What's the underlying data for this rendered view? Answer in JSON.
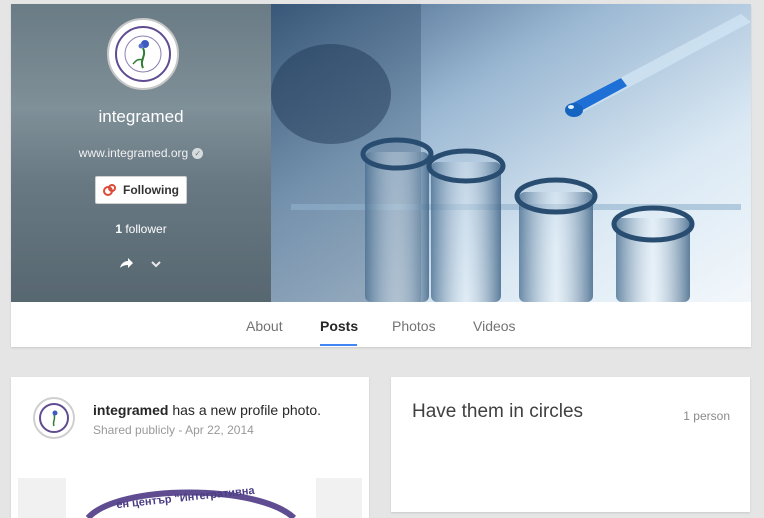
{
  "profile": {
    "name": "integramed",
    "website": "www.integramed.org",
    "follow_label": "Following",
    "followers_count": "1",
    "followers_label": " follower"
  },
  "tabs": [
    {
      "label": "About"
    },
    {
      "label": "Posts"
    },
    {
      "label": "Photos"
    },
    {
      "label": "Videos"
    }
  ],
  "post": {
    "author": "integramed",
    "action": " has a new profile photo.",
    "visibility": "Shared publicly",
    "separator": " - ",
    "date": "Apr 22, 2014",
    "image_text": "ен център \"Интегративна"
  },
  "circles": {
    "title": "Have them in circles",
    "count": "1 person"
  },
  "colors": {
    "accent": "#4285f4",
    "follow_icon": "#dd4b39",
    "logo": "#5f4c91"
  }
}
